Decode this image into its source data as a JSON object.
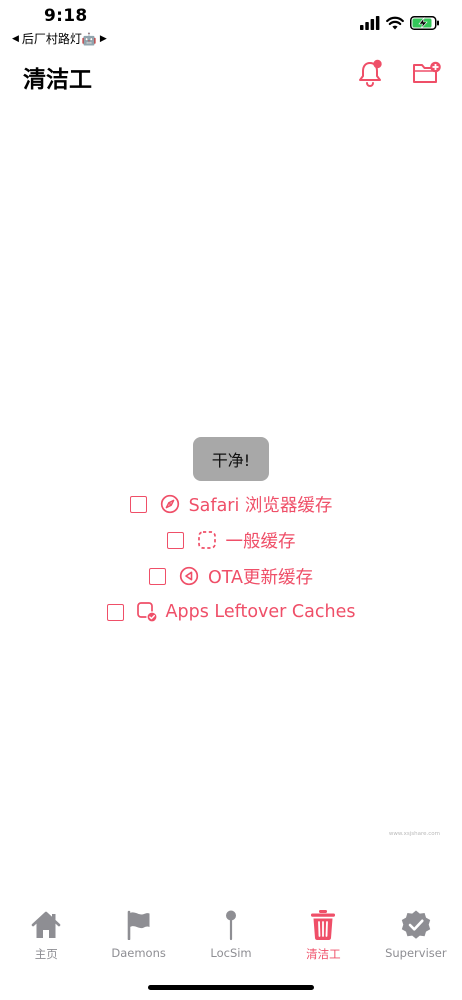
{
  "status_bar": {
    "time": "9:18",
    "back_app": "后厂村路灯🤖"
  },
  "header": {
    "title": "清洁工"
  },
  "main": {
    "clean_button_label": "干净!",
    "options": [
      {
        "label": "Safari 浏览器缓存",
        "icon": "compass-icon",
        "checked": false
      },
      {
        "label": "一般缓存",
        "icon": "dashed-square-icon",
        "checked": false
      },
      {
        "label": "OTA更新缓存",
        "icon": "circle-play-back-icon",
        "checked": false
      },
      {
        "label": "Apps Leftover Caches",
        "icon": "app-check-icon",
        "checked": false
      }
    ]
  },
  "watermark": "www.xsjshare.com",
  "tab_bar": {
    "items": [
      {
        "label": "主页",
        "icon": "house-icon",
        "active": false
      },
      {
        "label": "Daemons",
        "icon": "flag-icon",
        "active": false
      },
      {
        "label": "LocSim",
        "icon": "pin-icon",
        "active": false
      },
      {
        "label": "清洁工",
        "icon": "trash-icon",
        "active": true
      },
      {
        "label": "Superviser",
        "icon": "verified-badge-icon",
        "active": false
      }
    ]
  },
  "colors": {
    "accent": "#ef4f68",
    "inactive": "#8e8e93",
    "button_bg": "#a8a8a8",
    "battery_green": "#34c759"
  }
}
